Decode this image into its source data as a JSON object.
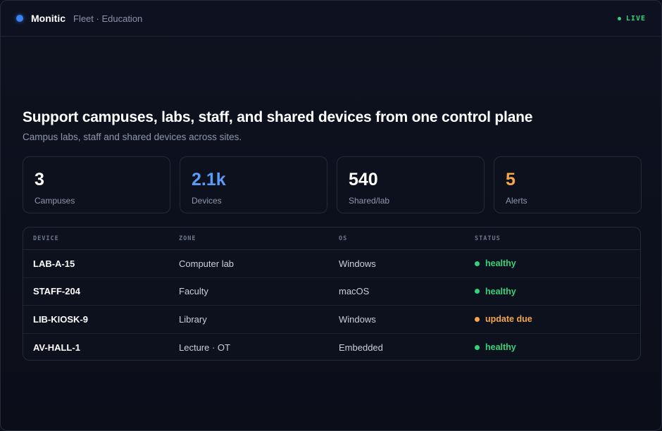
{
  "header": {
    "brand": "Monitic",
    "subtitle": "Fleet · Education",
    "live_label": "LIVE"
  },
  "hero": {
    "title": "Support campuses, labs, staff, and shared devices from one control plane",
    "subtitle": "Campus labs, staff and shared devices across sites."
  },
  "stats": [
    {
      "value": "3",
      "label": "Campuses",
      "color": "#ffffff"
    },
    {
      "value": "2.1k",
      "label": "Devices",
      "color": "#5b9cf6"
    },
    {
      "value": "540",
      "label": "Shared/lab",
      "color": "#ffffff"
    },
    {
      "value": "5",
      "label": "Alerts",
      "color": "#f5a54a"
    }
  ],
  "table": {
    "columns": [
      "DEVICE",
      "ZONE",
      "OS",
      "STATUS"
    ],
    "rows": [
      {
        "device": "LAB-A-15",
        "zone": "Computer lab",
        "os": "Windows",
        "status": "healthy",
        "status_color": "#34d27a"
      },
      {
        "device": "STAFF-204",
        "zone": "Faculty",
        "os": "macOS",
        "status": "healthy",
        "status_color": "#34d27a"
      },
      {
        "device": "LIB-KIOSK-9",
        "zone": "Library",
        "os": "Windows",
        "status": "update due",
        "status_color": "#f5a54a"
      },
      {
        "device": "AV-HALL-1",
        "zone": "Lecture · OT",
        "os": "Embedded",
        "status": "healthy",
        "status_color": "#34d27a"
      }
    ]
  },
  "colors": {
    "accent": "#3b82f6",
    "live": "#34d27a",
    "warning": "#f5a54a"
  }
}
